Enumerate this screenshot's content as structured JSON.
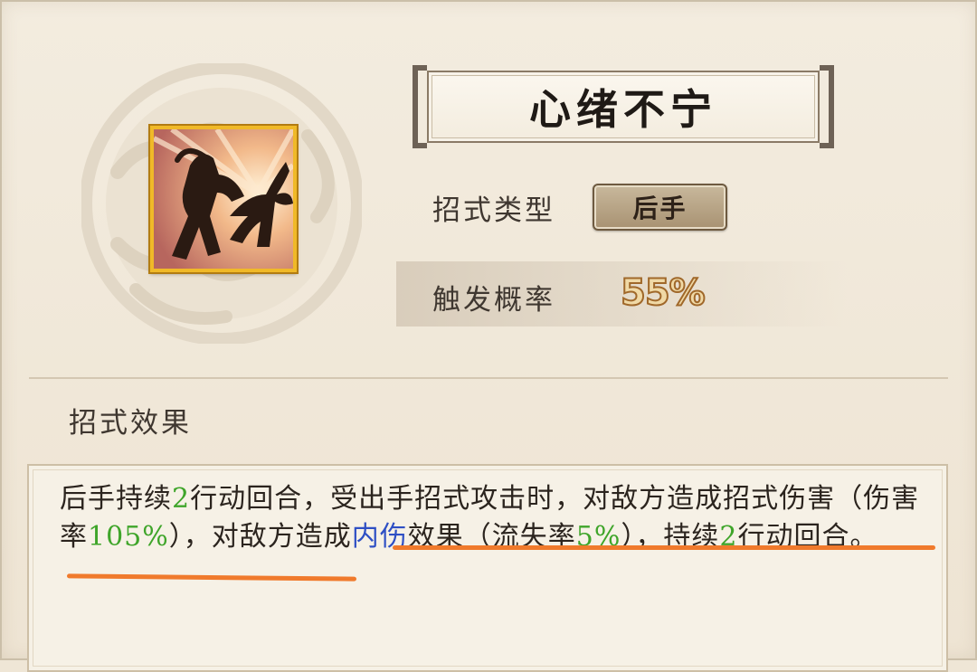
{
  "skill": {
    "name": "心绪不宁",
    "type_label": "招式类型",
    "type_value": "后手",
    "rate_label": "触发概率",
    "rate_value": "55%",
    "icon": "silhouette-fighters-icon"
  },
  "effect": {
    "label": "招式效果",
    "text": {
      "p1": "后手持续",
      "n1": "2",
      "p2": "行动回合，受出手招式攻击时，对敌方造成招式伤害（伤害率",
      "n2": "105%",
      "p3": "），对敌方造成",
      "n3": "内伤",
      "p4": "效果（流失率",
      "n4": "5%",
      "p5": "），持续",
      "n5": "2",
      "p6": "行动回合。"
    }
  },
  "colors": {
    "highlight_number": "#3fa52a",
    "highlight_status": "#2e4fc4",
    "annotation_underline": "#f07a2c",
    "icon_border": "#f0b928"
  }
}
